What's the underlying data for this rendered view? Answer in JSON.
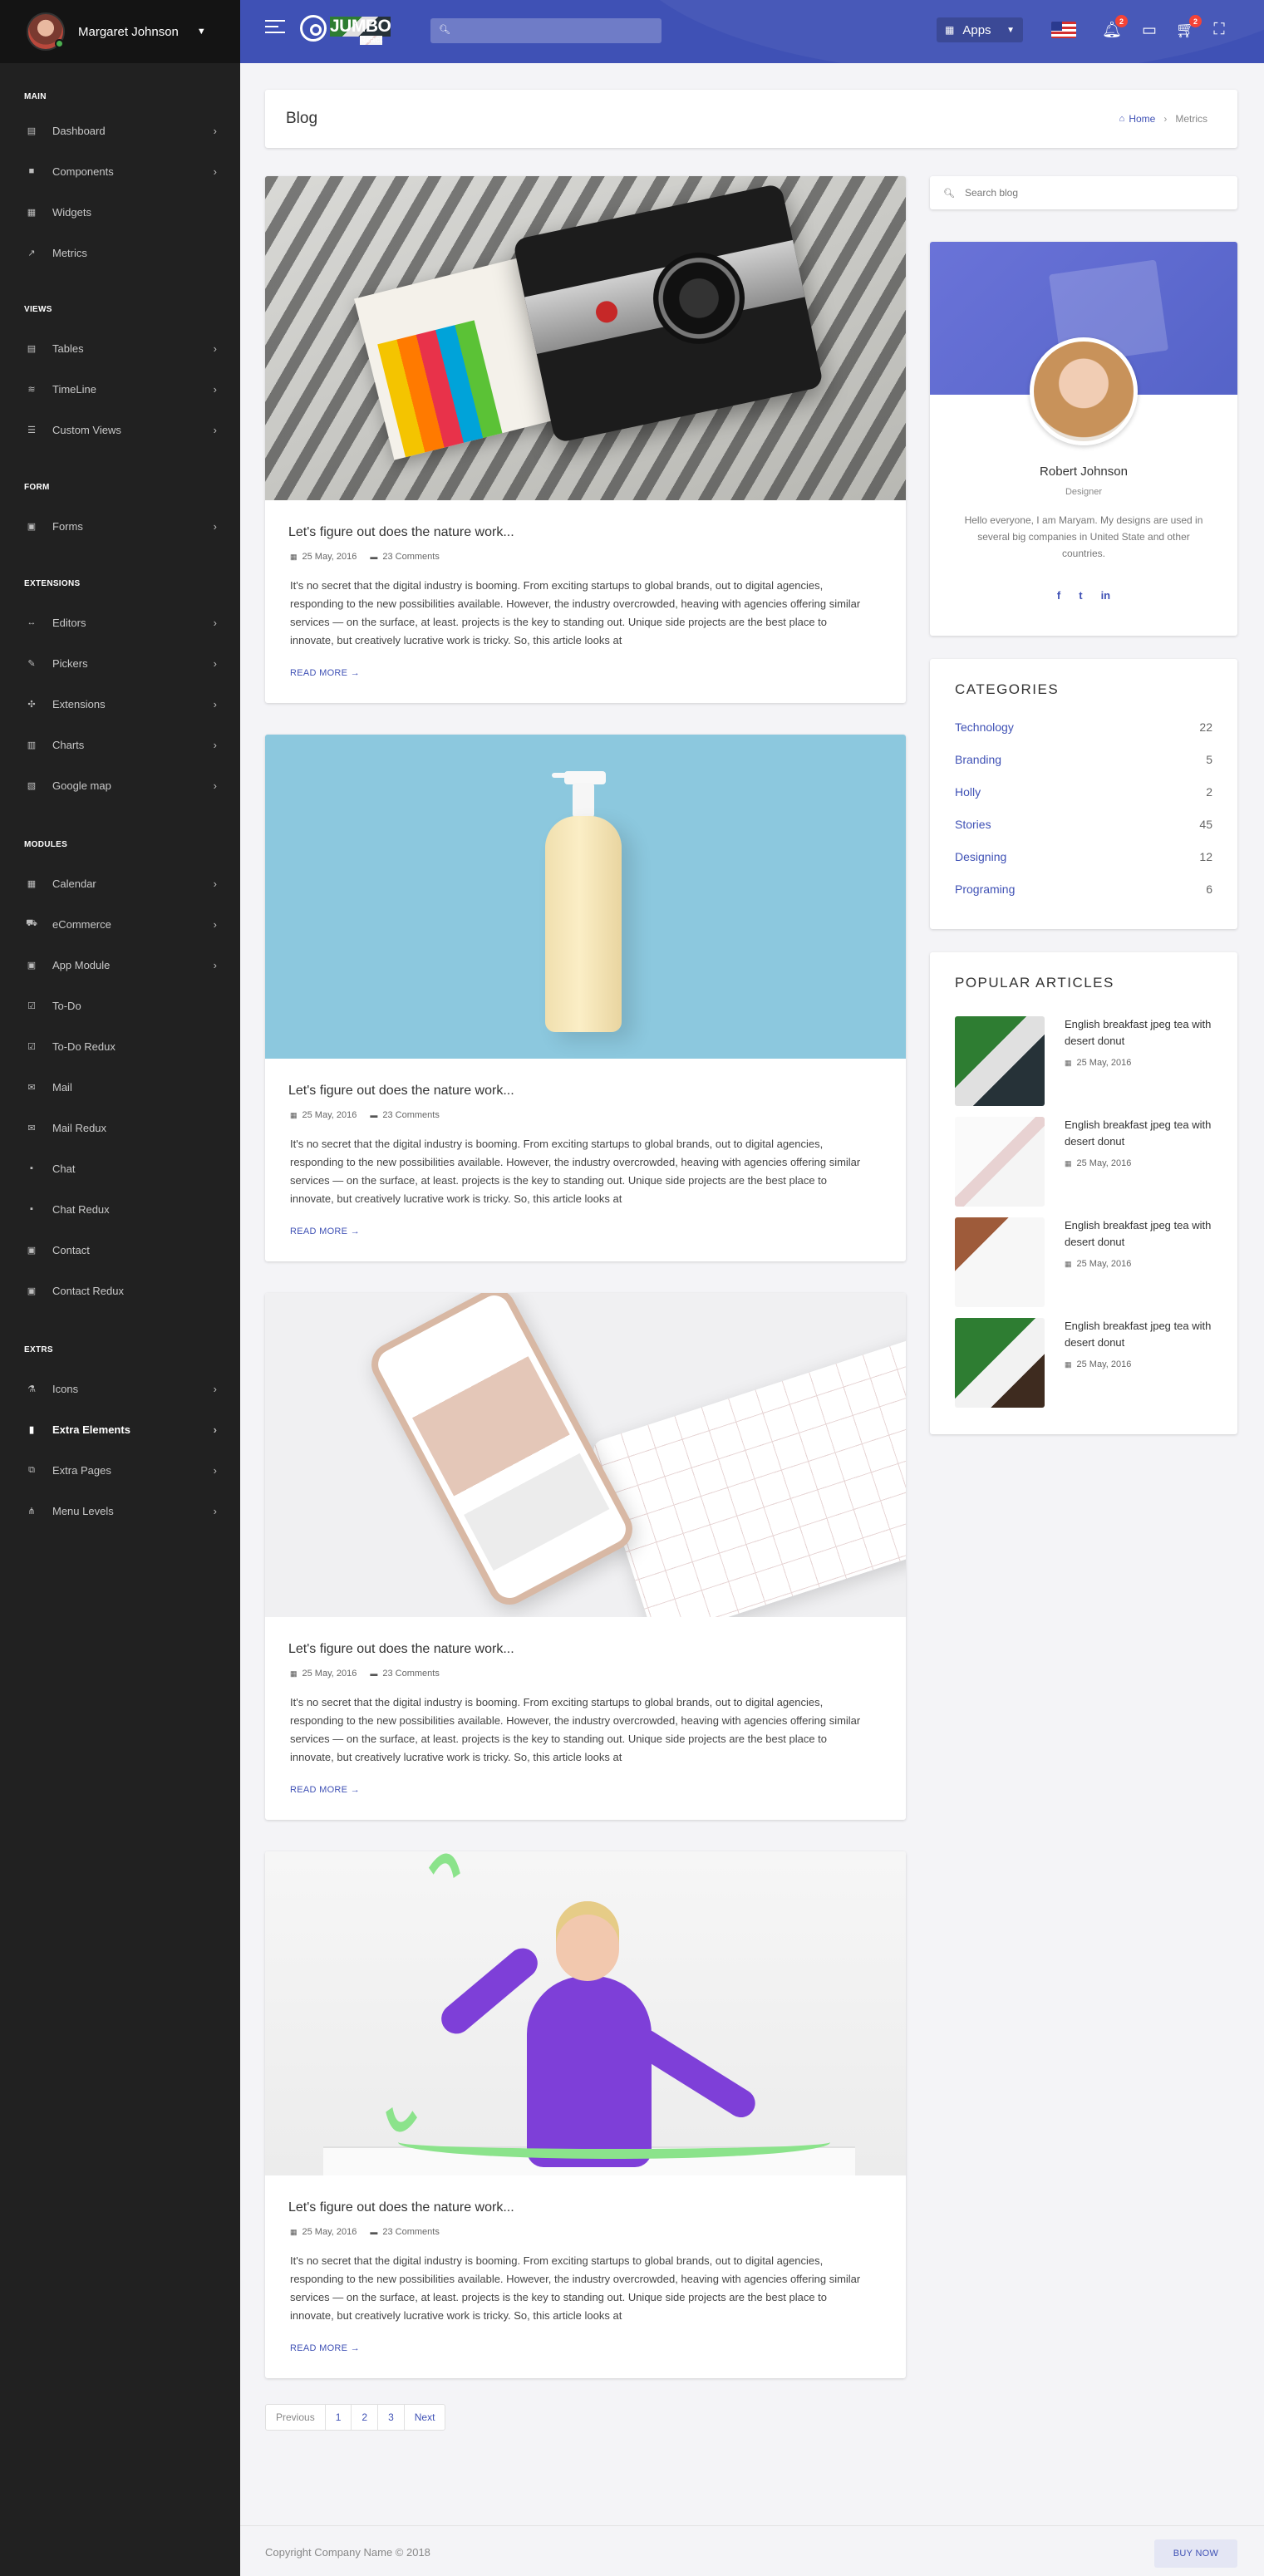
{
  "user": {
    "name": "Margaret Johnson"
  },
  "topbar": {
    "logo_text": "JUMBO",
    "logo_sub": "React",
    "apps_label": "Apps",
    "notifications_count": "2",
    "cart_count": "2"
  },
  "sidebar": {
    "sections": [
      {
        "title": "MAIN",
        "items": [
          {
            "label": "Dashboard",
            "icon": "dashboard-icon",
            "chevron": true
          },
          {
            "label": "Components",
            "icon": "folder-icon",
            "chevron": true
          },
          {
            "label": "Widgets",
            "icon": "widgets-grid-icon",
            "chevron": false
          },
          {
            "label": "Metrics",
            "icon": "trending-icon",
            "chevron": false
          }
        ]
      },
      {
        "title": "VIEWS",
        "items": [
          {
            "label": "Tables",
            "icon": "table-icon",
            "chevron": true
          },
          {
            "label": "TimeLine",
            "icon": "timeline-icon",
            "chevron": true
          },
          {
            "label": "Custom Views",
            "icon": "list-icon",
            "chevron": true
          }
        ]
      },
      {
        "title": "FORM",
        "items": [
          {
            "label": "Forms",
            "icon": "form-icon",
            "chevron": true
          }
        ]
      },
      {
        "title": "EXTENSIONS",
        "items": [
          {
            "label": "Editors",
            "icon": "code-icon",
            "chevron": true
          },
          {
            "label": "Pickers",
            "icon": "pencil-icon",
            "chevron": true
          },
          {
            "label": "Extensions",
            "icon": "puzzle-icon",
            "chevron": true
          },
          {
            "label": "Charts",
            "icon": "chart-icon",
            "chevron": true
          },
          {
            "label": "Google map",
            "icon": "map-icon",
            "chevron": true
          }
        ]
      },
      {
        "title": "MODULES",
        "items": [
          {
            "label": "Calendar",
            "icon": "calendar-icon",
            "chevron": true
          },
          {
            "label": "eCommerce",
            "icon": "cart-icon",
            "chevron": true
          },
          {
            "label": "App Module",
            "icon": "app-icon",
            "chevron": true
          },
          {
            "label": "To-Do",
            "icon": "checkbox-icon",
            "chevron": false
          },
          {
            "label": "To-Do Redux",
            "icon": "checkbox-icon",
            "chevron": false
          },
          {
            "label": "Mail",
            "icon": "mail-icon",
            "chevron": false
          },
          {
            "label": "Mail Redux",
            "icon": "mail-icon",
            "chevron": false
          },
          {
            "label": "Chat",
            "icon": "chat-icon",
            "chevron": false
          },
          {
            "label": "Chat Redux",
            "icon": "chat-icon",
            "chevron": false
          },
          {
            "label": "Contact",
            "icon": "contact-icon",
            "chevron": false
          },
          {
            "label": "Contact Redux",
            "icon": "contact-icon",
            "chevron": false
          }
        ]
      },
      {
        "title": "EXTRS",
        "items": [
          {
            "label": "Icons",
            "icon": "flask-icon",
            "chevron": true
          },
          {
            "label": "Extra Elements",
            "icon": "book-icon",
            "chevron": true,
            "active": true
          },
          {
            "label": "Extra Pages",
            "icon": "pages-icon",
            "chevron": true
          },
          {
            "label": "Menu Levels",
            "icon": "sitemap-icon",
            "chevron": true
          }
        ]
      }
    ]
  },
  "page": {
    "title": "Blog",
    "breadcrumb": {
      "home": "Home",
      "current": "Metrics"
    }
  },
  "posts": [
    {
      "title": "Let's figure out does the nature work...",
      "date": "25 May, 2016",
      "comments": "23 Comments",
      "excerpt": "It's no secret that the digital industry is booming. From exciting startups to global brands, out to digital agencies, responding to the new possibilities available. However, the industry overcrowded, heaving with agencies offering similar services — on the surface, at least. projects is the key to standing out. Unique side projects are the best place to innovate, but creatively lucrative work is tricky. So, this article looks at",
      "read_more": "READ MORE"
    },
    {
      "title": "Let's figure out does the nature work...",
      "date": "25 May, 2016",
      "comments": "23 Comments",
      "excerpt": "It's no secret that the digital industry is booming. From exciting startups to global brands, out to digital agencies, responding to the new possibilities available. However, the industry overcrowded, heaving with agencies offering similar services — on the surface, at least. projects is the key to standing out. Unique side projects are the best place to innovate, but creatively lucrative work is tricky. So, this article looks at",
      "read_more": "READ MORE"
    },
    {
      "title": "Let's figure out does the nature work...",
      "date": "25 May, 2016",
      "comments": "23 Comments",
      "excerpt": "It's no secret that the digital industry is booming. From exciting startups to global brands, out to digital agencies, responding to the new possibilities available. However, the industry overcrowded, heaving with agencies offering similar services — on the surface, at least. projects is the key to standing out. Unique side projects are the best place to innovate, but creatively lucrative work is tricky. So, this article looks at",
      "read_more": "READ MORE"
    },
    {
      "title": "Let's figure out does the nature work...",
      "date": "25 May, 2016",
      "comments": "23 Comments",
      "excerpt": "It's no secret that the digital industry is booming. From exciting startups to global brands, out to digital agencies, responding to the new possibilities available. However, the industry overcrowded, heaving with agencies offering similar services — on the surface, at least. projects is the key to standing out. Unique side projects are the best place to innovate, but creatively lucrative work is tricky. So, this article looks at",
      "read_more": "READ MORE"
    }
  ],
  "pagination": {
    "previous": "Previous",
    "pages": [
      "1",
      "2",
      "3"
    ],
    "next": "Next"
  },
  "sidebar_right": {
    "search_placeholder": "Search blog",
    "profile": {
      "name": "Robert Johnson",
      "role": "Designer",
      "bio": "Hello everyone, I am Maryam. My designs are used in several big companies in United State and other countries.",
      "social": [
        "facebook-icon",
        "twitter-icon",
        "linkedin-icon"
      ]
    },
    "categories": {
      "title": "CATEGORIES",
      "items": [
        {
          "name": "Technology",
          "count": "22"
        },
        {
          "name": "Branding",
          "count": "5"
        },
        {
          "name": "Holly",
          "count": "2"
        },
        {
          "name": "Stories",
          "count": "45"
        },
        {
          "name": "Designing",
          "count": "12"
        },
        {
          "name": "Programing",
          "count": "6"
        }
      ]
    },
    "popular": {
      "title": "POPULAR ARTICLES",
      "items": [
        {
          "title": "English breakfast jpeg tea with desert donut",
          "date": "25 May, 2016"
        },
        {
          "title": "English breakfast jpeg tea with desert donut",
          "date": "25 May, 2016"
        },
        {
          "title": "English breakfast jpeg tea with desert donut",
          "date": "25 May, 2016"
        },
        {
          "title": "English breakfast jpeg tea with desert donut",
          "date": "25 May, 2016"
        }
      ]
    }
  },
  "footer": {
    "copyright": "Copyright Company Name © 2018",
    "buy_label": "BUY NOW"
  },
  "colors": {
    "primary": "#3f51b5",
    "sidebar": "#212121",
    "sidebar_header": "#141414",
    "background": "#f4f4f7",
    "badge": "#f44336",
    "online": "#4caf50"
  }
}
